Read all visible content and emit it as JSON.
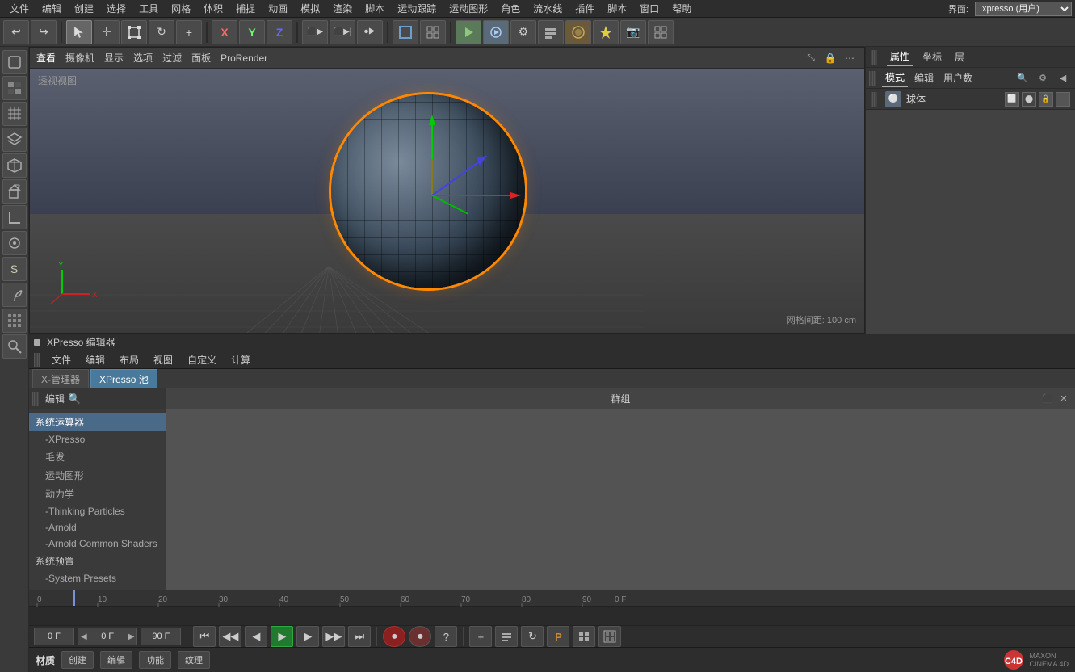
{
  "topmenu": {
    "items": [
      "文件",
      "编辑",
      "创建",
      "选择",
      "工具",
      "网格",
      "体积",
      "捕捉",
      "动画",
      "模拟",
      "渲染",
      "脚本",
      "运动跟踪",
      "运动图形",
      "角色",
      "流水线",
      "插件",
      "脚本",
      "窗口",
      "帮助"
    ],
    "interface_label": "界面:",
    "interface_value": "xpresso (用户)"
  },
  "toolbar": {
    "undo_label": "↩",
    "redo_label": "↪",
    "move_icon": "✛",
    "scale_icon": "⊞",
    "rotate_icon": "↻",
    "transform_icon": "+",
    "x_label": "X",
    "y_label": "Y",
    "z_label": "Z",
    "world_icon": "⊡",
    "view_icons": [
      "⬛",
      "⬜",
      "◧",
      "⊟",
      "⬡",
      "🔲"
    ]
  },
  "viewport": {
    "tabs": [
      "查看",
      "摄像机",
      "显示",
      "选项",
      "过滤",
      "面板",
      "ProRender"
    ],
    "label": "透视视图",
    "grid_distance": "网格间距: 100 cm",
    "axes": {
      "x": "X",
      "y": "Y",
      "z": "Z"
    }
  },
  "right_panel": {
    "tabs": [
      "属性",
      "坐标",
      "层"
    ],
    "sub_tabs": [
      "模式",
      "编辑",
      "用户数"
    ],
    "object_label": "球体"
  },
  "xpresso": {
    "title": "XPresso 编辑器",
    "menu_items": [
      "文件",
      "编辑",
      "布局",
      "视图",
      "自定义",
      "计算"
    ],
    "tabs": [
      "X-管理器",
      "XPresso 池"
    ],
    "active_tab": "XPresso 池",
    "node_group_label": "群组",
    "list_toolbar_label": "编辑",
    "list_items": [
      {
        "label": "系统运算器",
        "type": "category"
      },
      {
        "label": "-XPresso",
        "type": "subitem"
      },
      {
        "label": "毛发",
        "type": "subitem"
      },
      {
        "label": "运动图形",
        "type": "subitem"
      },
      {
        "label": "动力学",
        "type": "subitem"
      },
      {
        "label": "-Thinking Particles",
        "type": "subitem"
      },
      {
        "label": "-Arnold",
        "type": "subitem"
      },
      {
        "label": "-Arnold Common Shaders",
        "type": "subitem"
      },
      {
        "label": "系统预置",
        "type": "category"
      },
      {
        "label": "-System Presets",
        "type": "subitem"
      }
    ]
  },
  "timeline": {
    "markers": [
      "0",
      "10",
      "20",
      "30",
      "40",
      "50",
      "60",
      "70",
      "80",
      "90",
      "0 F"
    ],
    "current_frame": "0 F",
    "end_frame": "90 F"
  },
  "playback": {
    "start_frame": "0 F",
    "current_frame_input": "0 F",
    "end_frame": "90 F",
    "buttons": [
      "⏮",
      "◀◀",
      "◀",
      "▶",
      "▶▶",
      "⏭"
    ],
    "record_auto_label": "⏺",
    "play_label": "▶",
    "help_label": "?",
    "extra_icons": [
      "+",
      "⊡",
      "↻",
      "P",
      "⊞",
      "≡"
    ]
  },
  "materials": {
    "label": "材质",
    "buttons": [
      "创建",
      "编辑",
      "功能",
      "纹理"
    ]
  }
}
